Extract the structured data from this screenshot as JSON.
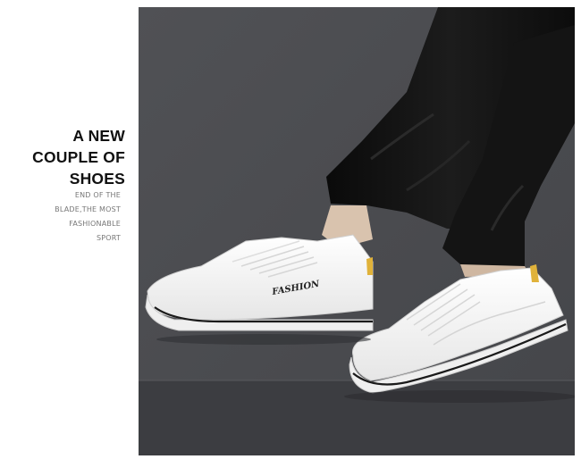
{
  "headline": {
    "lines": [
      "A NEW",
      "COUPLE OF",
      "SHOES"
    ]
  },
  "tagline": {
    "lines": [
      "END OF THE",
      "BLADE,THE MOST",
      "FASHIONABLE",
      "SPORT"
    ]
  },
  "photo": {
    "shoe_brand_text": "FASHION",
    "colors": {
      "wall": "#4a4b4f",
      "floor": "#3a3b3f",
      "pants": "#101010",
      "shoe": "#f4f4f4",
      "sole_stripe": "#1a1a1a",
      "heel_accent": "#e0b23a",
      "skin": "#d8c2ae"
    }
  }
}
